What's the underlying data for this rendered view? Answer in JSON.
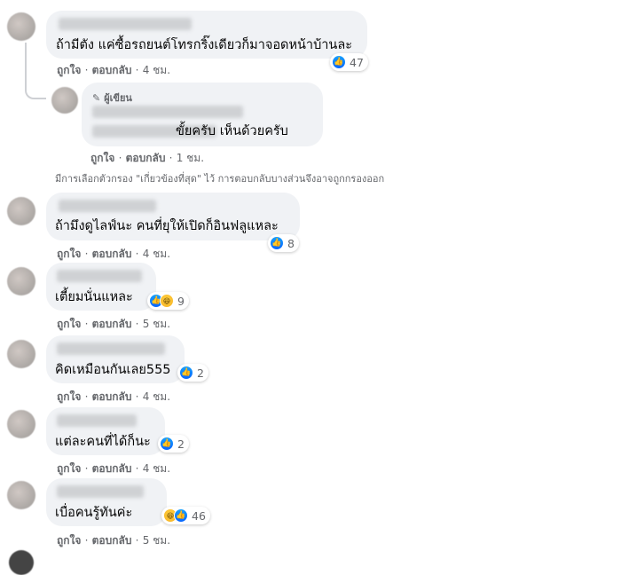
{
  "actions": {
    "like": "ถูกใจ",
    "reply": "ตอบกลับ",
    "dot": "·"
  },
  "comments": [
    {
      "text": "ถ้ามีตัง แค่ซื้อรถยนต์โทรกริ๊งเดียวก็มาจอดหน้าบ้านละ",
      "time": "4 ชม.",
      "reactions": [
        "like"
      ],
      "count": "47"
    },
    {
      "text": "ถ้ามึงดูไลฟ์นะ คนที่ยุให้เปิดก็อินฟลูแหละ",
      "time": "4 ชม.",
      "reactions": [
        "like"
      ],
      "count": "8"
    },
    {
      "text": "เตี้ยมนั่นแหละ",
      "time": "5 ชม.",
      "reactions": [
        "like",
        "haha"
      ],
      "count": "9"
    },
    {
      "text": "คิดเหมือนกันเลย555",
      "time": "4 ชม.",
      "reactions": [
        "like"
      ],
      "count": "2"
    },
    {
      "text": "แต่ละคนที่ได้ก็นะ",
      "time": "4 ชม.",
      "reactions": [
        "like"
      ],
      "count": "2"
    },
    {
      "text": "เบื่อคนรู้ทันค่ะ",
      "time": "5 ชม.",
      "reactions": [
        "haha",
        "like"
      ],
      "count": "46"
    }
  ],
  "reply": {
    "author_tag": "ผู้เขียน",
    "text": "ขั้ยครับ เห็นด้วยครับ",
    "time": "1 ชม."
  },
  "filter_note": "มีการเลือกตัวกรอง \"เกี่ยวข้องที่สุด\" ไว้ การตอบกลับบางส่วนจึงอาจถูกกรองออก",
  "colors": {
    "like": "#0866ff",
    "haha": "#f7b125",
    "meta": "#65676b",
    "bubble": "#f0f2f5"
  }
}
